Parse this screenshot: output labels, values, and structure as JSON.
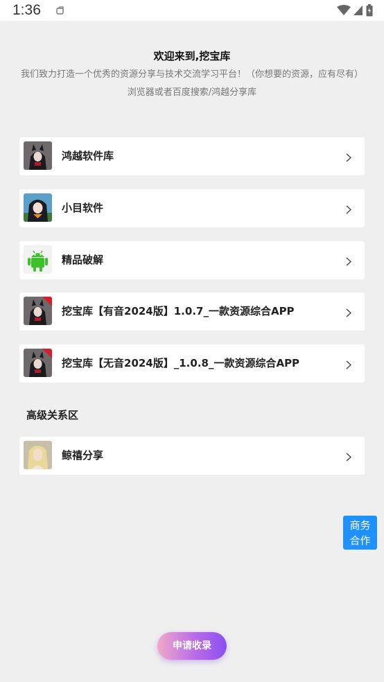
{
  "status": {
    "time": "1:36"
  },
  "header": {
    "welcome": "欢迎来到,挖宝库",
    "description": "我们致力打造一个优秀的资源分享与技术交流学习平台！（你想要的资源，应有尽有）",
    "search_hint": "浏览器或者百度搜索/鸿越分享库"
  },
  "links": [
    {
      "label": "鸿越软件库",
      "icon": "anime-avatar-icon"
    },
    {
      "label": "小目软件",
      "icon": "anime-girl-icon"
    },
    {
      "label": "精品破解",
      "icon": "android-robot-icon"
    },
    {
      "label": "挖宝库【有音2024版】1.0.7_一款资源综合APP",
      "icon": "anime-avatar-badge-icon"
    },
    {
      "label": "挖宝库【无音2024版】_1.0.8_一款资源综合APP",
      "icon": "anime-avatar-badge-icon"
    }
  ],
  "advanced": {
    "title": "高级关系区",
    "links": [
      {
        "label": "鲸禧分享",
        "icon": "blonde-portrait-icon"
      }
    ]
  },
  "business": {
    "line1": "商务",
    "line2": "合作"
  },
  "apply_button": "申请收录",
  "colors": {
    "background": "#efefef",
    "card": "#ffffff",
    "business_blue": "#1e90ff",
    "apply_gradient_start": "#f0a9c8",
    "apply_gradient_end": "#8b4ff0"
  }
}
